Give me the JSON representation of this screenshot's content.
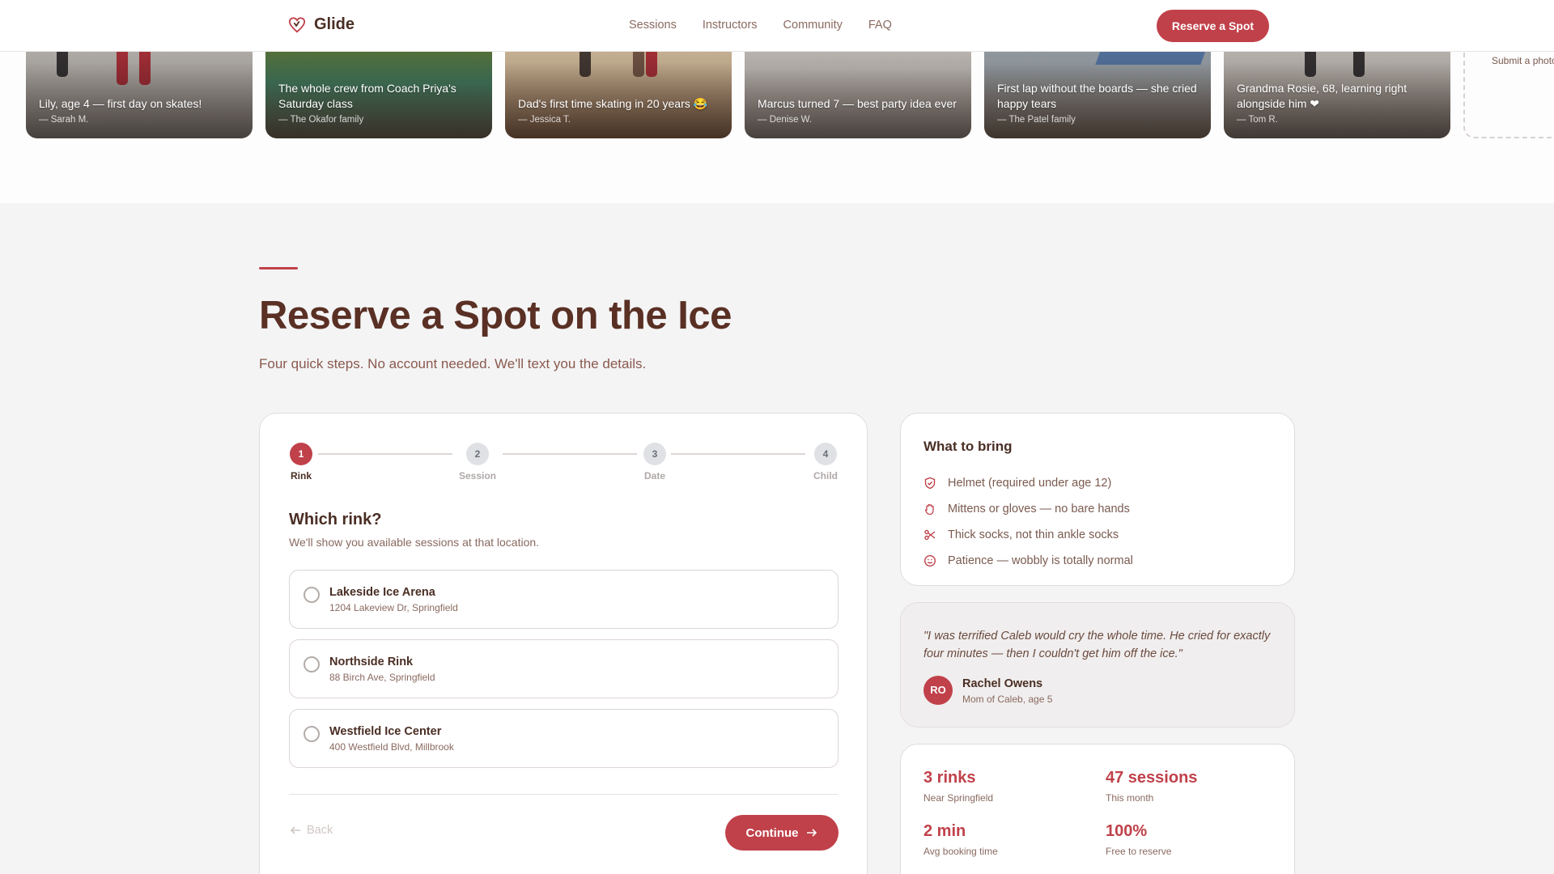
{
  "nav": {
    "brand": "Glide",
    "links": [
      "Sessions",
      "Instructors",
      "Community",
      "FAQ"
    ],
    "cta": "Reserve a Spot"
  },
  "gallery": {
    "photos": [
      {
        "caption": "Lily, age 4 — first day on skates!",
        "author": "— Sarah M."
      },
      {
        "caption": "The whole crew from Coach Priya's Saturday class",
        "author": "— The Okafor family"
      },
      {
        "caption": "Dad's first time skating in 20 years 😂",
        "author": "— Jessica T."
      },
      {
        "caption": "Marcus turned 7 — best party idea ever",
        "author": "— Denise W."
      },
      {
        "caption": "First lap without the boards — she cried happy tears",
        "author": "— The Patel family"
      },
      {
        "caption": "Grandma Rosie, 68, learning right alongside him ❤",
        "author": "— Tom R."
      }
    ],
    "submit_label": "Submit a photo"
  },
  "reserve": {
    "title": "Reserve a Spot on the Ice",
    "subtitle": "Four quick steps. No account needed. We'll text you the details."
  },
  "stepper": {
    "steps": [
      {
        "number": "1",
        "label": "Rink"
      },
      {
        "number": "2",
        "label": "Session"
      },
      {
        "number": "3",
        "label": "Date"
      },
      {
        "number": "4",
        "label": "Child"
      }
    ],
    "active": 1
  },
  "question": {
    "title": "Which rink?",
    "help": "We'll show you available sessions at that location."
  },
  "rinks": [
    {
      "name": "Lakeside Ice Arena",
      "address": "1204 Lakeview Dr, Springfield"
    },
    {
      "name": "Northside Rink",
      "address": "88 Birch Ave, Springfield"
    },
    {
      "name": "Westfield Ice Center",
      "address": "400 Westfield Blvd, Millbrook"
    }
  ],
  "actions": {
    "back": "Back",
    "continue": "Continue"
  },
  "bring": {
    "title": "What to bring",
    "items": [
      {
        "text": "Helmet (required under age 12)",
        "icon": "shield-icon"
      },
      {
        "text": "Mittens or gloves — no bare hands",
        "icon": "hand-icon"
      },
      {
        "text": "Thick socks, not thin ankle socks",
        "icon": "scissors-icon"
      },
      {
        "text": "Patience — wobbly is totally normal",
        "icon": "smile-icon"
      }
    ]
  },
  "testimonial": {
    "quote": "\"I was terrified Caleb would cry the whole time. He cried for exactly four minutes — then I couldn't get him off the ice.\"",
    "initials": "RO",
    "name": "Rachel Owens",
    "role": "Mom of Caleb, age 5"
  },
  "stats": [
    {
      "value": "3 rinks",
      "label": "Near Springfield"
    },
    {
      "value": "47 sessions",
      "label": "This month"
    },
    {
      "value": "2 min",
      "label": "Avg booking time"
    },
    {
      "value": "100%",
      "label": "Free to reserve"
    }
  ],
  "colors": {
    "accent": "#c0414a",
    "heading": "#5a3024",
    "muted": "#8a6a60"
  }
}
